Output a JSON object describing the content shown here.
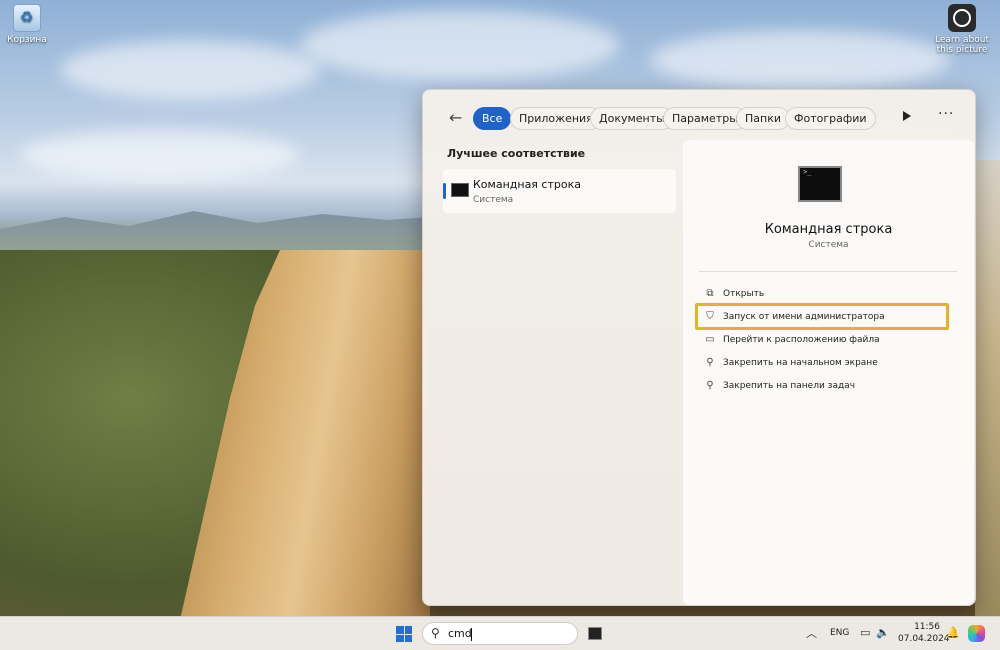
{
  "desktop": {
    "recycle_bin_label": "Корзина",
    "learn_label": "Learn about this picture"
  },
  "search": {
    "filters": [
      "Все",
      "Приложения",
      "Документы",
      "Параметры",
      "Папки",
      "Фотографии"
    ],
    "best_match_heading": "Лучшее соответствие",
    "best_match": {
      "title": "Командная строка",
      "subtitle": "Система"
    },
    "detail": {
      "title": "Командная строка",
      "subtitle": "Система",
      "actions": [
        {
          "label": "Открыть",
          "icon": "open-icon"
        },
        {
          "label": "Запуск от имени администратора",
          "icon": "shield-icon"
        },
        {
          "label": "Перейти к расположению файла",
          "icon": "folder-icon"
        },
        {
          "label": "Закрепить на начальном экране",
          "icon": "pin-icon"
        },
        {
          "label": "Закрепить на панели задач",
          "icon": "pin-icon"
        }
      ]
    },
    "highlight_color": "#e3b526"
  },
  "taskbar": {
    "search_value": "cmd",
    "language": "ENG",
    "time": "11:56",
    "date": "07.04.2024"
  }
}
